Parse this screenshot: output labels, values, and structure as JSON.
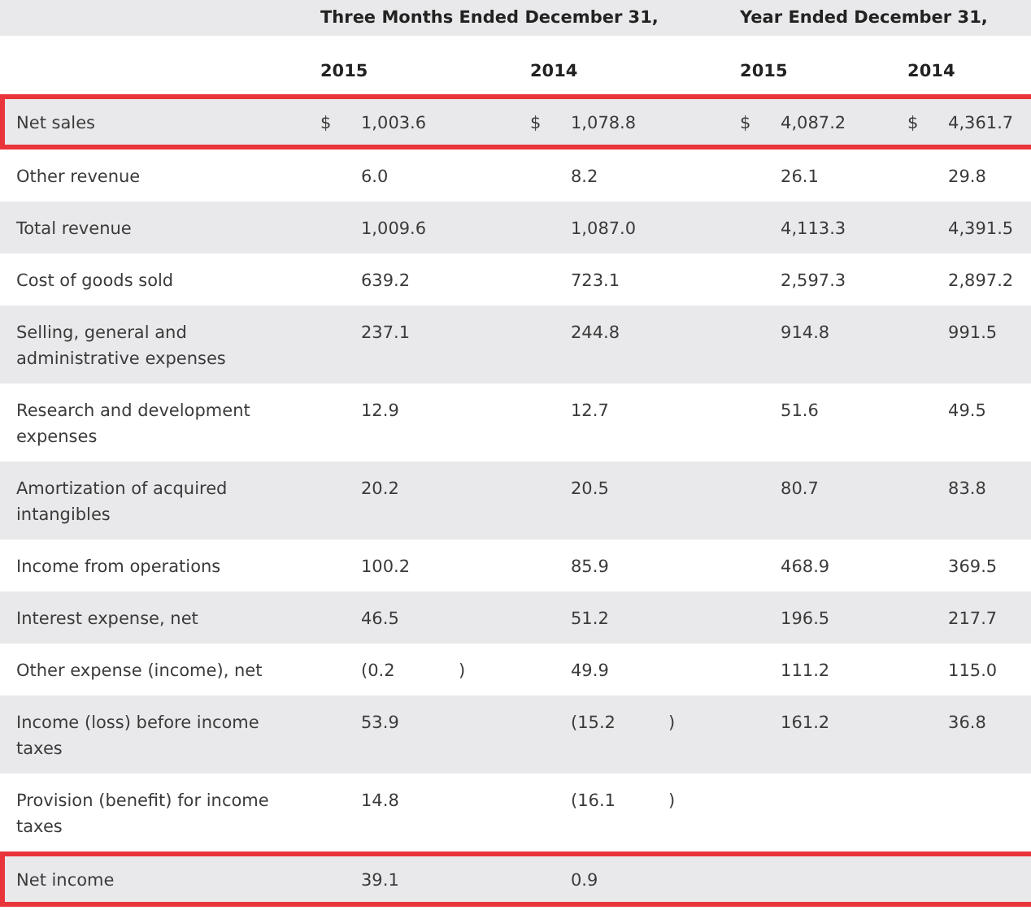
{
  "column_groups": [
    {
      "label": "Three Months Ended December 31,"
    },
    {
      "label": "Year Ended December 31,"
    }
  ],
  "years": [
    "2015",
    "2014",
    "2015",
    "2014"
  ],
  "rows": [
    {
      "label": "Net sales",
      "highlighted": true,
      "cells": [
        {
          "currency": "$",
          "value": "1,003.6"
        },
        {
          "currency": "$",
          "value": "1,078.8"
        },
        {
          "currency": "$",
          "value": "4,087.2"
        },
        {
          "currency": "$",
          "value": "4,361.7"
        }
      ]
    },
    {
      "label": "Other revenue",
      "highlighted": false,
      "cells": [
        {
          "value": "6.0"
        },
        {
          "value": "8.2"
        },
        {
          "value": "26.1"
        },
        {
          "value": "29.8"
        }
      ]
    },
    {
      "label": "Total revenue",
      "highlighted": false,
      "cells": [
        {
          "value": "1,009.6"
        },
        {
          "value": "1,087.0"
        },
        {
          "value": "4,113.3"
        },
        {
          "value": "4,391.5"
        }
      ]
    },
    {
      "label": "Cost of goods sold",
      "highlighted": false,
      "cells": [
        {
          "value": "639.2"
        },
        {
          "value": "723.1"
        },
        {
          "value": "2,597.3"
        },
        {
          "value": "2,897.2"
        }
      ]
    },
    {
      "label": "Selling, general and administrative expenses",
      "highlighted": false,
      "cells": [
        {
          "value": "237.1"
        },
        {
          "value": "244.8"
        },
        {
          "value": "914.8"
        },
        {
          "value": "991.5"
        }
      ]
    },
    {
      "label": "Research and development expenses",
      "highlighted": false,
      "cells": [
        {
          "value": "12.9"
        },
        {
          "value": "12.7"
        },
        {
          "value": "51.6"
        },
        {
          "value": "49.5"
        }
      ]
    },
    {
      "label": "Amortization of acquired intangibles",
      "highlighted": false,
      "cells": [
        {
          "value": "20.2"
        },
        {
          "value": "20.5"
        },
        {
          "value": "80.7"
        },
        {
          "value": "83.8"
        }
      ]
    },
    {
      "label": "Income from operations",
      "highlighted": false,
      "cells": [
        {
          "value": "100.2"
        },
        {
          "value": "85.9"
        },
        {
          "value": "468.9"
        },
        {
          "value": "369.5"
        }
      ]
    },
    {
      "label": "Interest expense, net",
      "highlighted": false,
      "cells": [
        {
          "value": "46.5"
        },
        {
          "value": "51.2"
        },
        {
          "value": "196.5"
        },
        {
          "value": "217.7"
        }
      ]
    },
    {
      "label": "Other expense (income), net",
      "highlighted": false,
      "cells": [
        {
          "value": "(0.2",
          "close": ")"
        },
        {
          "value": "49.9"
        },
        {
          "value": "111.2"
        },
        {
          "value": "115.0"
        }
      ]
    },
    {
      "label": "Income (loss) before income taxes",
      "highlighted": false,
      "cells": [
        {
          "value": "53.9"
        },
        {
          "value": "(15.2",
          "close": ")"
        },
        {
          "value": "161.2"
        },
        {
          "value": "36.8"
        }
      ]
    },
    {
      "label": "Provision (benefit) for income taxes",
      "highlighted": false,
      "cells": [
        {
          "value": "14.8"
        },
        {
          "value": "(16.1",
          "close": ")"
        },
        {},
        {}
      ]
    },
    {
      "label": "Net income",
      "highlighted": true,
      "cells": [
        {
          "value": "39.1"
        },
        {
          "value": "0.9"
        },
        {},
        {}
      ]
    }
  ]
}
